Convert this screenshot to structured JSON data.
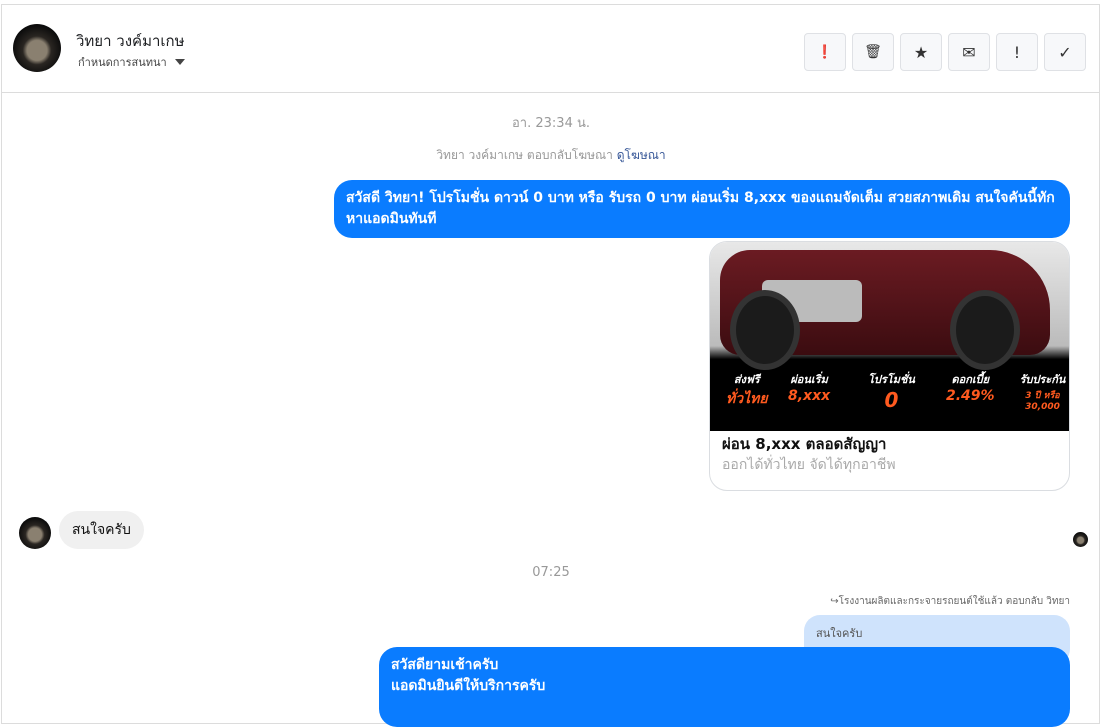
{
  "header": {
    "name": "วิทยา วงค์มาเกษ",
    "subtitle": "กำหนดการสนทนา"
  },
  "toolbar": [
    {
      "icon": "alert-circle-icon",
      "glyph": "❗"
    },
    {
      "icon": "trash-icon",
      "glyph": "🗑"
    },
    {
      "icon": "star-icon",
      "glyph": "★"
    },
    {
      "icon": "envelope-icon",
      "glyph": "✉"
    },
    {
      "icon": "exclamation-icon",
      "glyph": "!"
    },
    {
      "icon": "check-icon",
      "glyph": "✓"
    }
  ],
  "messages": {
    "time1": "อา. 23:34 น.",
    "ad_reply_text": "วิทยา วงค์มาเกษ ตอบกลับโฆษณา",
    "ad_link": "ดูโฆษณา",
    "out1": "สวัสดี วิทยา! โปรโมชั่น ดาวน์ 0 บาท หรือ รับรถ 0 บาท ผ่อนเริ่ม 8,xxx ของแถมจัดเต็ม สวยสภาพเดิม สนใจคันนี้ทักหาแอดมินทันที",
    "card": {
      "title": "ผ่อน 8,xxx ตลอดสัญญา",
      "subtitle": "ออกได้ทั่วไทย จัดได้ทุกอาชีพ",
      "banner": [
        {
          "t": "ส่งฟรี",
          "v": "ทั่วไทย"
        },
        {
          "t": "ผ่อนเริ่ม",
          "v": "8,xxx"
        },
        {
          "t": "โปรโมชั่น",
          "v": "0"
        },
        {
          "t": "ดอกเบี้ย",
          "v": "2.49%"
        },
        {
          "t": "รับประกัน",
          "v": "3 ปี หรือ 30,000"
        }
      ]
    },
    "in1": "สนใจครับ",
    "time2": "07:25",
    "reply_note": "↪โรงงานผลิตและกระจายรถยนต์ใช้แล้ว ตอบกลับ วิทยา",
    "quoted": "สนใจครับ",
    "out2_line1": "สวัสดียามเช้าครับ",
    "out2_line2": "แอดมินยินดีให้บริการครับ"
  }
}
